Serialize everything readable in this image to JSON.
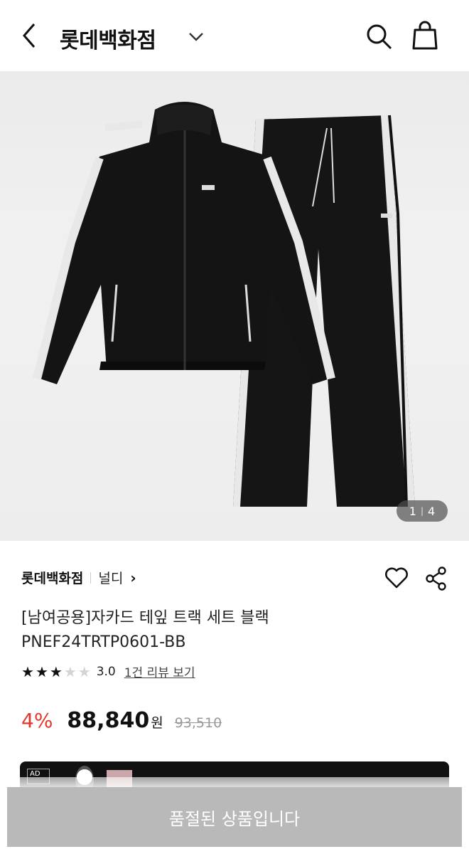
{
  "header": {
    "store_title": "롯데백화점"
  },
  "gallery": {
    "current": "1",
    "total": "4"
  },
  "product": {
    "department": "롯데백화점",
    "brand": "널디",
    "title_line1": "[남여공용]자카드 테잎 트랙 세트 블랙",
    "title_line2": "PNEF24TRTP0601-BB",
    "rating": 3,
    "rating_max": 5,
    "score": "3.0",
    "reviews_link": "1건 리뷰 보기",
    "discount": "4%",
    "price": "88,840",
    "currency": "원",
    "original_price": "93,510"
  },
  "ad": {
    "tag": "AD"
  },
  "bottom": {
    "soldout_label": "품절된 상품입니다"
  },
  "colors": {
    "discount": "#e0392b",
    "soldout_bg": "#b9b9b9"
  }
}
